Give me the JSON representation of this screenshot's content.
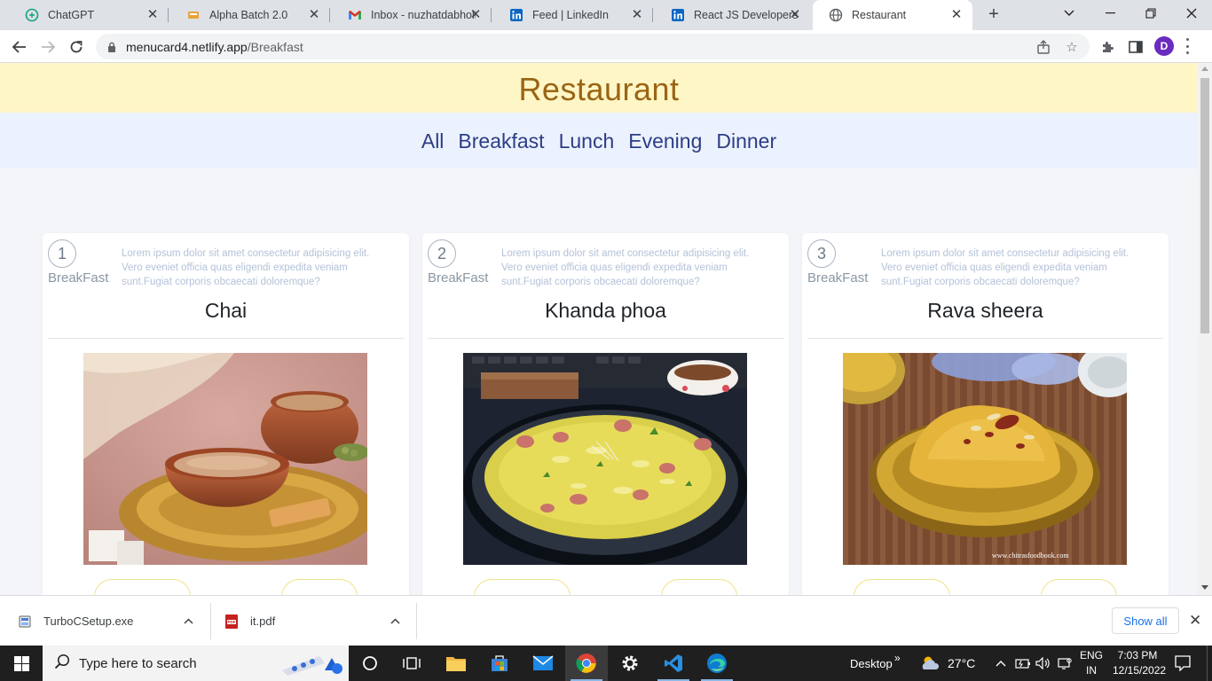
{
  "browser": {
    "tabs": [
      {
        "title": "ChatGPT",
        "icon": "chatgpt-icon",
        "active": false
      },
      {
        "title": "Alpha Batch 2.0",
        "icon": "alpha-batch-icon",
        "active": false
      },
      {
        "title": "Inbox - nuzhatdabholk",
        "icon": "gmail-icon",
        "active": false
      },
      {
        "title": "Feed | LinkedIn",
        "icon": "linkedin-icon",
        "active": false
      },
      {
        "title": "React JS Developers (",
        "icon": "linkedin-icon",
        "active": false
      },
      {
        "title": "Restaurant",
        "icon": "globe-icon",
        "active": true
      }
    ],
    "url_host": "menucard4.netlify.app",
    "url_path": "/Breakfast",
    "profile_initial": "D"
  },
  "site": {
    "title": "Restaurant",
    "nav": [
      "All",
      "Breakfast",
      "Lunch",
      "Evening",
      "Dinner"
    ],
    "colors": {
      "header_bg": "#fef6c6",
      "title": "#9a6414",
      "nav_bg": "#ecf2fd",
      "nav_text": "#2c3d86",
      "pill_border": "#f2e28a"
    }
  },
  "menu_items": [
    {
      "id": "1",
      "category": "BreakFast",
      "name": "Chai",
      "description": "Lorem ipsum dolor sit amet consectetur adipisicing elit. Vero eveniet officia quas eligendi expedita veniam sunt.Fugiat corporis obcaecati doloremque?"
    },
    {
      "id": "2",
      "category": "BreakFast",
      "name": "Khanda phoa",
      "description": "Lorem ipsum dolor sit amet consectetur adipisicing elit. Vero eveniet officia quas eligendi expedita veniam sunt.Fugiat corporis obcaecati doloremque?"
    },
    {
      "id": "3",
      "category": "BreakFast",
      "name": "Rava sheera",
      "description": "Lorem ipsum dolor sit amet consectetur adipisicing elit. Vero eveniet officia quas eligendi expedita veniam sunt.Fugiat corporis obcaecati doloremque?",
      "watermark": "www.chitrasfoodbook.com"
    }
  ],
  "downloads": {
    "items": [
      {
        "name": "TurboCSetup.exe",
        "icon": "installer-icon"
      },
      {
        "name": "it.pdf",
        "icon": "pdf-icon"
      }
    ],
    "show_all": "Show all"
  },
  "taskbar": {
    "search_placeholder": "Type here to search",
    "desktop_label": "Desktop",
    "temperature": "27°C",
    "lang_line1": "ENG",
    "lang_line2": "IN",
    "time": "7:03 PM",
    "date": "12/15/2022"
  }
}
